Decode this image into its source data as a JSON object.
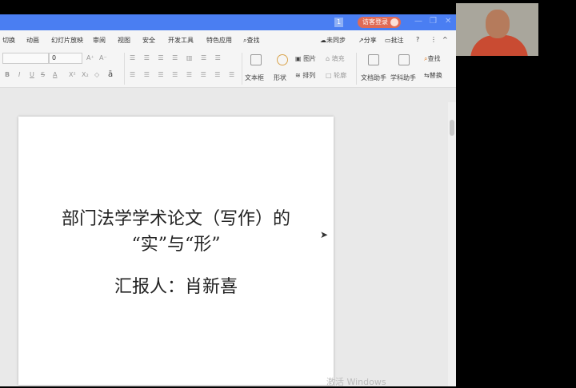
{
  "titlebar": {
    "badge": "1",
    "login": "访客登录",
    "minimize": "—",
    "restore": "❐",
    "close": "✕"
  },
  "menu": {
    "items": [
      "切换",
      "动画",
      "幻灯片放映",
      "审阅",
      "视图",
      "安全",
      "开发工具",
      "特色应用",
      "查找"
    ],
    "right": [
      "未同步",
      "分享",
      "批注",
      "?",
      "⋮",
      "^"
    ]
  },
  "toolbar": {
    "font_size": "0",
    "font_grow": "A⁺",
    "font_shrink": "A⁻",
    "bold": "B",
    "italic": "I",
    "underline": "U",
    "strike": "S",
    "font_color": "A",
    "superscript": "X²",
    "subscript": "X₂",
    "clear": "◇",
    "text_effect": "ā",
    "textbox": "文本框",
    "shape": "形状",
    "picture": "图片",
    "arrange": "排列",
    "fill": "填充",
    "outline": "轮廓",
    "doc_assistant": "文档助手",
    "subject_assistant": "学科助手",
    "find": "查找",
    "replace": "替换"
  },
  "slide": {
    "title_line1": "部门法学学术论文（写作）的",
    "title_line2": "“实”与“形”",
    "presenter": "汇报人：肖新喜"
  },
  "watermark": "激活 Windows"
}
